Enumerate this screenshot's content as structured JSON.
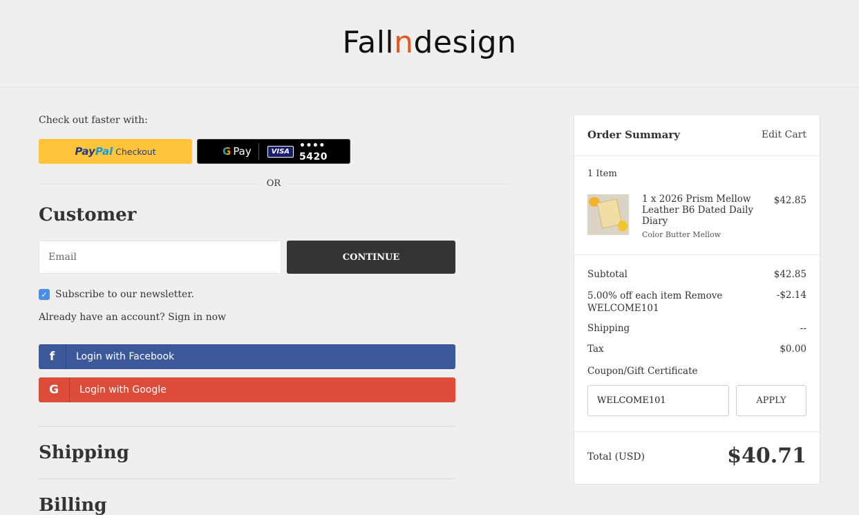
{
  "header": {
    "logo_prefix": "Fall",
    "logo_accent": "n",
    "logo_suffix": "design",
    "accent_color": "#e0581f"
  },
  "checkout_fast": {
    "label": "Check out faster with:",
    "paypal": {
      "pay": "Pay",
      "pal": "Pal",
      "checkout": "Checkout"
    },
    "gpay": {
      "g": "G",
      "pay": "Pay",
      "card_brand": "VISA",
      "card_last": "•••• 5420"
    },
    "or": "OR"
  },
  "customer": {
    "heading": "Customer",
    "email_placeholder": "Email",
    "email_value": "",
    "continue_label": "CONTINUE",
    "newsletter_label": "Subscribe to our newsletter.",
    "newsletter_checked": true,
    "account_prompt": "Already have an account?",
    "sign_in_label": "Sign in now",
    "facebook": {
      "icon": "f",
      "label": "Login with Facebook"
    },
    "google": {
      "icon": "G",
      "label": "Login with Google"
    }
  },
  "sections": {
    "shipping": "Shipping",
    "billing": "Billing"
  },
  "summary": {
    "title": "Order Summary",
    "edit_cart": "Edit Cart",
    "item_count": "1 Item",
    "item": {
      "name": "1 x 2026 Prism Mellow Leather B6 Dated Daily Diary",
      "variant": "Color Butter Mellow",
      "price": "$42.85"
    },
    "subtotal_label": "Subtotal",
    "subtotal_value": "$42.85",
    "discount_label": "5.00% off each item",
    "discount_remove": "Remove",
    "discount_code": "WELCOME101",
    "discount_value": "-$2.14",
    "shipping_label": "Shipping",
    "shipping_value": "--",
    "tax_label": "Tax",
    "tax_value": "$0.00",
    "coupon_label": "Coupon/Gift Certificate",
    "coupon_value": "WELCOME101",
    "apply_label": "APPLY",
    "total_label": "Total (USD)",
    "total_value": "$40.71"
  }
}
